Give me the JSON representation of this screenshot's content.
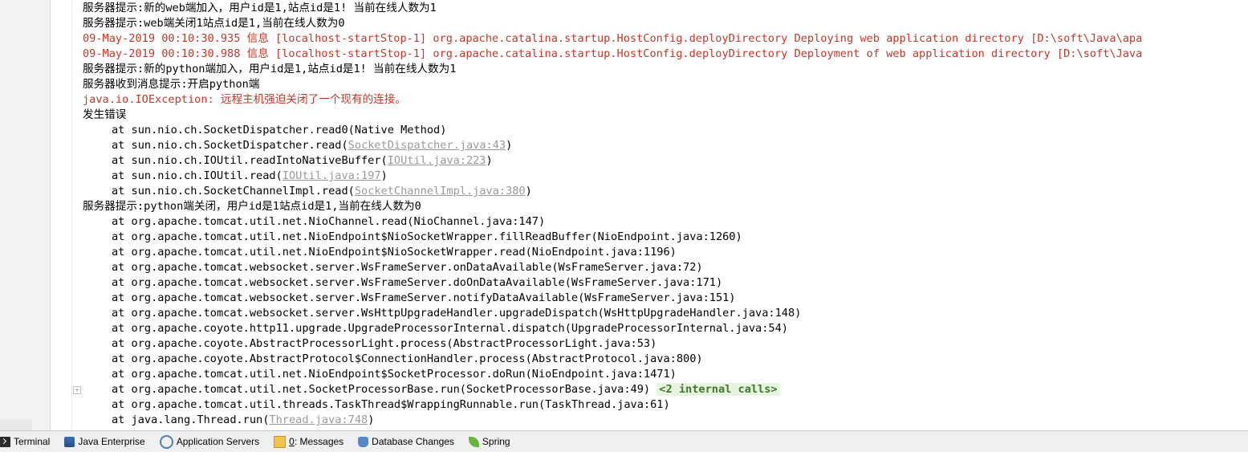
{
  "console": {
    "lines": [
      "服务器提示:新的web端加入，用户id是1,站点id是1! 当前在线人数为1",
      "服务器提示:web端关闭1站点id是1,当前在线人数为0",
      "09-May-2019 00:10:30.935 信息 [localhost-startStop-1] org.apache.catalina.startup.HostConfig.deployDirectory Deploying web application directory [D:\\soft\\Java\\apa",
      "09-May-2019 00:10:30.988 信息 [localhost-startStop-1] org.apache.catalina.startup.HostConfig.deployDirectory Deployment of web application directory [D:\\soft\\Java",
      "服务器提示:新的python端加入，用户id是1,站点id是1! 当前在线人数为1",
      "服务器收到消息提示:开启python端",
      "java.io.IOException: 远程主机强迫关闭了一个现有的连接。",
      "发生错误",
      "at sun.nio.ch.SocketDispatcher.read0(Native Method)",
      "at sun.nio.ch.SocketDispatcher.read(",
      "SocketDispatcher.java:43",
      ")",
      "at sun.nio.ch.IOUtil.readIntoNativeBuffer(",
      "IOUtil.java:223",
      ")",
      "at sun.nio.ch.IOUtil.read(",
      "IOUtil.java:197",
      ")",
      "at sun.nio.ch.SocketChannelImpl.read(",
      "SocketChannelImpl.java:380",
      ")",
      "服务器提示:python端关闭，用户id是1站点id是1,当前在线人数为0",
      "at org.apache.tomcat.util.net.NioChannel.read(NioChannel.java:147)",
      "at org.apache.tomcat.util.net.NioEndpoint$NioSocketWrapper.fillReadBuffer(NioEndpoint.java:1260)",
      "at org.apache.tomcat.util.net.NioEndpoint$NioSocketWrapper.read(NioEndpoint.java:1196)",
      "at org.apache.tomcat.websocket.server.WsFrameServer.onDataAvailable(WsFrameServer.java:72)",
      "at org.apache.tomcat.websocket.server.WsFrameServer.doOnDataAvailable(WsFrameServer.java:171)",
      "at org.apache.tomcat.websocket.server.WsFrameServer.notifyDataAvailable(WsFrameServer.java:151)",
      "at org.apache.tomcat.websocket.server.WsHttpUpgradeHandler.upgradeDispatch(WsHttpUpgradeHandler.java:148)",
      "at org.apache.coyote.http11.upgrade.UpgradeProcessorInternal.dispatch(UpgradeProcessorInternal.java:54)",
      "at org.apache.coyote.AbstractProcessorLight.process(AbstractProcessorLight.java:53)",
      "at org.apache.coyote.AbstractProtocol$ConnectionHandler.process(AbstractProtocol.java:800)",
      "at org.apache.tomcat.util.net.NioEndpoint$SocketProcessor.doRun(NioEndpoint.java:1471)",
      "at org.apache.tomcat.util.net.SocketProcessorBase.run(SocketProcessorBase.java:49)",
      "<2 internal calls>",
      "at org.apache.tomcat.util.threads.TaskThread$WrappingRunnable.run(TaskThread.java:61)",
      "at java.lang.Thread.run(",
      "Thread.java:748",
      ")"
    ]
  },
  "gutter": {
    "fold_symbol": "+"
  },
  "statusbar": {
    "tabs": [
      {
        "label": "Terminal",
        "icon": "terminal-icon"
      },
      {
        "label": "Java Enterprise",
        "icon": "java-enterprise-icon"
      },
      {
        "label": "Application Servers",
        "icon": "application-servers-icon"
      },
      {
        "label_mnemonic": "0",
        "label_rest": ": Messages",
        "icon": "messages-icon"
      },
      {
        "label": "Database Changes",
        "icon": "database-icon"
      },
      {
        "label": "Spring",
        "icon": "spring-icon"
      }
    ]
  },
  "colors": {
    "error_text": "#c0392b",
    "link_text": "#9a9a9a",
    "internal_calls_bg": "#e8f2e1",
    "internal_calls_text": "#3d7a2c"
  }
}
